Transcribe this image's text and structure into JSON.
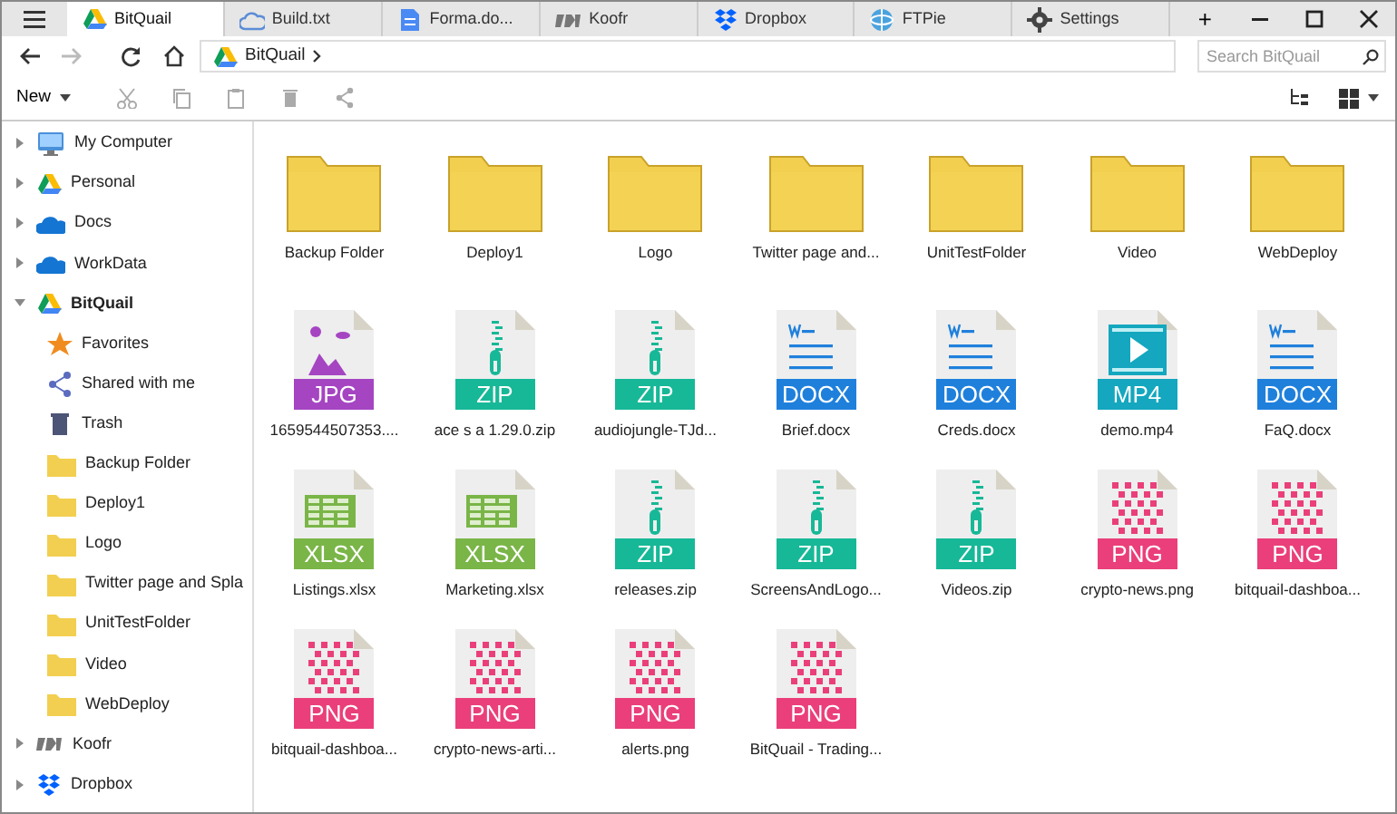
{
  "tabs": [
    {
      "label": "BitQuail",
      "selected": true
    },
    {
      "label": "Build.txt",
      "selected": false
    },
    {
      "label": "Forma.do...",
      "selected": false
    },
    {
      "label": "Koofr",
      "selected": false
    },
    {
      "label": "Dropbox",
      "selected": false
    },
    {
      "label": "FTPie",
      "selected": false
    },
    {
      "label": "Settings",
      "selected": false
    }
  ],
  "new_tab": "+",
  "address": {
    "path": "BitQuail"
  },
  "search": {
    "placeholder": "Search BitQuail"
  },
  "toolbar": {
    "new_label": "New"
  },
  "sidebar": {
    "items": [
      {
        "label": "My Computer",
        "expanded": false,
        "selected": false
      },
      {
        "label": "Personal",
        "expanded": false,
        "selected": false
      },
      {
        "label": "Docs",
        "expanded": false,
        "selected": false
      },
      {
        "label": "WorkData",
        "expanded": false,
        "selected": false
      },
      {
        "label": "BitQuail",
        "expanded": true,
        "selected": true,
        "children": [
          {
            "label": "Favorites"
          },
          {
            "label": "Shared with me"
          },
          {
            "label": "Trash"
          },
          {
            "label": "Backup Folder"
          },
          {
            "label": "Deploy1"
          },
          {
            "label": "Logo"
          },
          {
            "label": "Twitter page and Spla"
          },
          {
            "label": "UnitTestFolder"
          },
          {
            "label": "Video"
          },
          {
            "label": "WebDeploy"
          }
        ]
      },
      {
        "label": "Koofr",
        "expanded": false,
        "selected": false
      },
      {
        "label": "Dropbox",
        "expanded": false,
        "selected": false
      }
    ]
  },
  "files": [
    {
      "name": "Backup Folder",
      "kind": "folder"
    },
    {
      "name": "Deploy1",
      "kind": "folder"
    },
    {
      "name": "Logo",
      "kind": "folder"
    },
    {
      "name": "Twitter page and...",
      "kind": "folder"
    },
    {
      "name": "UnitTestFolder",
      "kind": "folder"
    },
    {
      "name": "Video",
      "kind": "folder"
    },
    {
      "name": "WebDeploy",
      "kind": "folder"
    },
    {
      "name": "1659544507353....",
      "kind": "jpg",
      "badge": "JPG"
    },
    {
      "name": "ace s a 1.29.0.zip",
      "kind": "zip",
      "badge": "ZIP"
    },
    {
      "name": "audiojungle-TJd...",
      "kind": "zip",
      "badge": "ZIP"
    },
    {
      "name": "Brief.docx",
      "kind": "docx",
      "badge": "DOCX"
    },
    {
      "name": "Creds.docx",
      "kind": "docx",
      "badge": "DOCX"
    },
    {
      "name": "demo.mp4",
      "kind": "mp4",
      "badge": "MP4"
    },
    {
      "name": "FaQ.docx",
      "kind": "docx",
      "badge": "DOCX"
    },
    {
      "name": "Listings.xlsx",
      "kind": "xlsx",
      "badge": "XLSX"
    },
    {
      "name": "Marketing.xlsx",
      "kind": "xlsx",
      "badge": "XLSX"
    },
    {
      "name": "releases.zip",
      "kind": "zip",
      "badge": "ZIP"
    },
    {
      "name": "ScreensAndLogo...",
      "kind": "zip",
      "badge": "ZIP"
    },
    {
      "name": "Videos.zip",
      "kind": "zip",
      "badge": "ZIP"
    },
    {
      "name": "crypto-news.png",
      "kind": "png",
      "badge": "PNG"
    },
    {
      "name": "bitquail-dashboa...",
      "kind": "png",
      "badge": "PNG"
    },
    {
      "name": "bitquail-dashboa...",
      "kind": "png",
      "badge": "PNG"
    },
    {
      "name": "crypto-news-arti...",
      "kind": "png",
      "badge": "PNG"
    },
    {
      "name": "alerts.png",
      "kind": "png",
      "badge": "PNG"
    },
    {
      "name": "BitQuail - Trading...",
      "kind": "png",
      "badge": "PNG"
    }
  ]
}
